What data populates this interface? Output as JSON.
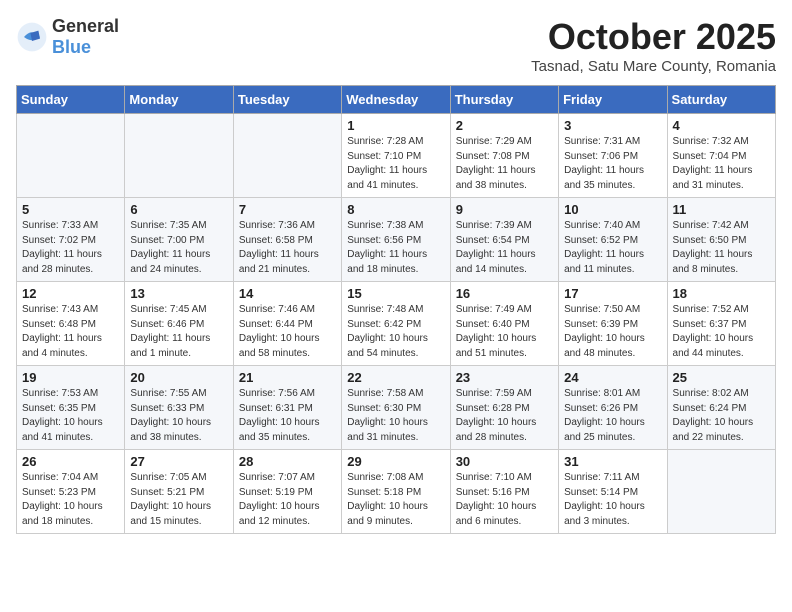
{
  "header": {
    "logo_general": "General",
    "logo_blue": "Blue",
    "month": "October 2025",
    "location": "Tasnad, Satu Mare County, Romania"
  },
  "weekdays": [
    "Sunday",
    "Monday",
    "Tuesday",
    "Wednesday",
    "Thursday",
    "Friday",
    "Saturday"
  ],
  "weeks": [
    [
      {
        "day": "",
        "info": ""
      },
      {
        "day": "",
        "info": ""
      },
      {
        "day": "",
        "info": ""
      },
      {
        "day": "1",
        "info": "Sunrise: 7:28 AM\nSunset: 7:10 PM\nDaylight: 11 hours and 41 minutes."
      },
      {
        "day": "2",
        "info": "Sunrise: 7:29 AM\nSunset: 7:08 PM\nDaylight: 11 hours and 38 minutes."
      },
      {
        "day": "3",
        "info": "Sunrise: 7:31 AM\nSunset: 7:06 PM\nDaylight: 11 hours and 35 minutes."
      },
      {
        "day": "4",
        "info": "Sunrise: 7:32 AM\nSunset: 7:04 PM\nDaylight: 11 hours and 31 minutes."
      }
    ],
    [
      {
        "day": "5",
        "info": "Sunrise: 7:33 AM\nSunset: 7:02 PM\nDaylight: 11 hours and 28 minutes."
      },
      {
        "day": "6",
        "info": "Sunrise: 7:35 AM\nSunset: 7:00 PM\nDaylight: 11 hours and 24 minutes."
      },
      {
        "day": "7",
        "info": "Sunrise: 7:36 AM\nSunset: 6:58 PM\nDaylight: 11 hours and 21 minutes."
      },
      {
        "day": "8",
        "info": "Sunrise: 7:38 AM\nSunset: 6:56 PM\nDaylight: 11 hours and 18 minutes."
      },
      {
        "day": "9",
        "info": "Sunrise: 7:39 AM\nSunset: 6:54 PM\nDaylight: 11 hours and 14 minutes."
      },
      {
        "day": "10",
        "info": "Sunrise: 7:40 AM\nSunset: 6:52 PM\nDaylight: 11 hours and 11 minutes."
      },
      {
        "day": "11",
        "info": "Sunrise: 7:42 AM\nSunset: 6:50 PM\nDaylight: 11 hours and 8 minutes."
      }
    ],
    [
      {
        "day": "12",
        "info": "Sunrise: 7:43 AM\nSunset: 6:48 PM\nDaylight: 11 hours and 4 minutes."
      },
      {
        "day": "13",
        "info": "Sunrise: 7:45 AM\nSunset: 6:46 PM\nDaylight: 11 hours and 1 minute."
      },
      {
        "day": "14",
        "info": "Sunrise: 7:46 AM\nSunset: 6:44 PM\nDaylight: 10 hours and 58 minutes."
      },
      {
        "day": "15",
        "info": "Sunrise: 7:48 AM\nSunset: 6:42 PM\nDaylight: 10 hours and 54 minutes."
      },
      {
        "day": "16",
        "info": "Sunrise: 7:49 AM\nSunset: 6:40 PM\nDaylight: 10 hours and 51 minutes."
      },
      {
        "day": "17",
        "info": "Sunrise: 7:50 AM\nSunset: 6:39 PM\nDaylight: 10 hours and 48 minutes."
      },
      {
        "day": "18",
        "info": "Sunrise: 7:52 AM\nSunset: 6:37 PM\nDaylight: 10 hours and 44 minutes."
      }
    ],
    [
      {
        "day": "19",
        "info": "Sunrise: 7:53 AM\nSunset: 6:35 PM\nDaylight: 10 hours and 41 minutes."
      },
      {
        "day": "20",
        "info": "Sunrise: 7:55 AM\nSunset: 6:33 PM\nDaylight: 10 hours and 38 minutes."
      },
      {
        "day": "21",
        "info": "Sunrise: 7:56 AM\nSunset: 6:31 PM\nDaylight: 10 hours and 35 minutes."
      },
      {
        "day": "22",
        "info": "Sunrise: 7:58 AM\nSunset: 6:30 PM\nDaylight: 10 hours and 31 minutes."
      },
      {
        "day": "23",
        "info": "Sunrise: 7:59 AM\nSunset: 6:28 PM\nDaylight: 10 hours and 28 minutes."
      },
      {
        "day": "24",
        "info": "Sunrise: 8:01 AM\nSunset: 6:26 PM\nDaylight: 10 hours and 25 minutes."
      },
      {
        "day": "25",
        "info": "Sunrise: 8:02 AM\nSunset: 6:24 PM\nDaylight: 10 hours and 22 minutes."
      }
    ],
    [
      {
        "day": "26",
        "info": "Sunrise: 7:04 AM\nSunset: 5:23 PM\nDaylight: 10 hours and 18 minutes."
      },
      {
        "day": "27",
        "info": "Sunrise: 7:05 AM\nSunset: 5:21 PM\nDaylight: 10 hours and 15 minutes."
      },
      {
        "day": "28",
        "info": "Sunrise: 7:07 AM\nSunset: 5:19 PM\nDaylight: 10 hours and 12 minutes."
      },
      {
        "day": "29",
        "info": "Sunrise: 7:08 AM\nSunset: 5:18 PM\nDaylight: 10 hours and 9 minutes."
      },
      {
        "day": "30",
        "info": "Sunrise: 7:10 AM\nSunset: 5:16 PM\nDaylight: 10 hours and 6 minutes."
      },
      {
        "day": "31",
        "info": "Sunrise: 7:11 AM\nSunset: 5:14 PM\nDaylight: 10 hours and 3 minutes."
      },
      {
        "day": "",
        "info": ""
      }
    ]
  ]
}
